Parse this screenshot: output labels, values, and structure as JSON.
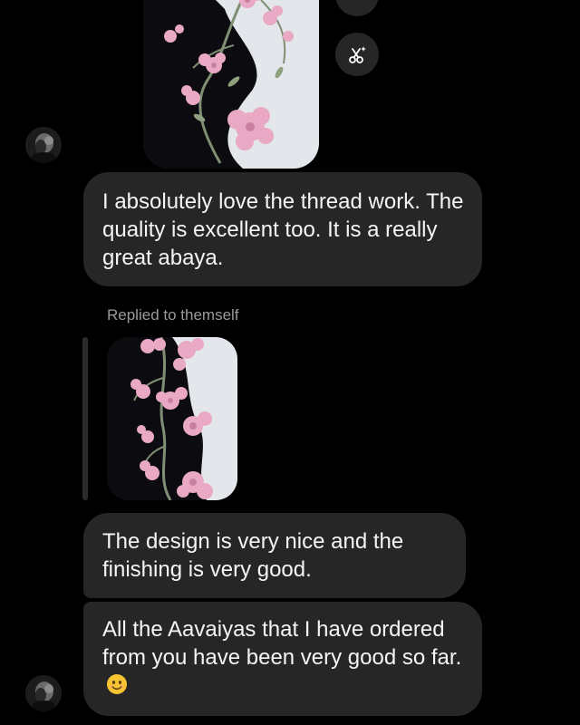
{
  "thread": {
    "reply_label": "Replied to themself",
    "messages": [
      {
        "type": "photo",
        "description": "embroidered abaya sleeve"
      },
      {
        "type": "text",
        "text": "I absolutely love the thread work. The quality is excellent too. It is a really great abaya."
      },
      {
        "type": "photo_reply",
        "description": "embroidered abaya detail"
      },
      {
        "type": "text",
        "text": "The design is very nice and the finishing is very good."
      },
      {
        "type": "text",
        "text": "All the Aavaiyas that I have ordered from you have been very good so far.",
        "emoji": "smiling-face-emoji"
      }
    ]
  },
  "actions": {
    "share_icon": "share-icon",
    "magic_icon": "ai-restyle-icon"
  },
  "colors": {
    "background": "#000000",
    "bubble": "#262626",
    "text": "#f5f5f5",
    "secondary_text": "#9a9a9a",
    "action_button": "#262626"
  }
}
